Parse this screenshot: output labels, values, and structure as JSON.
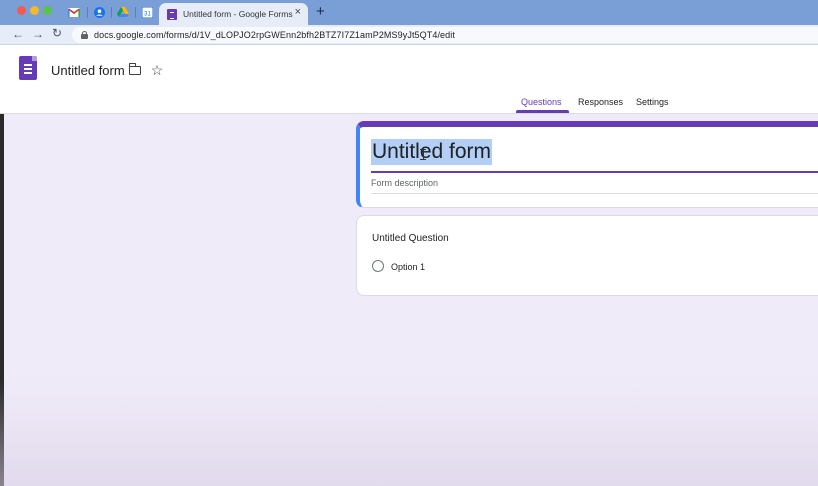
{
  "browser": {
    "tab_title": "Untitled form - Google Forms",
    "url": "docs.google.com/forms/d/1V_dLOPJO2rpGWEnn2bfh2BTZ7I7Z1amP2MS9yJt5QT4/edit",
    "new_tab_symbol": "+",
    "close_symbol": "×",
    "back_symbol": "←",
    "forward_symbol": "→",
    "reload_symbol": "↻",
    "pinned_tabs": [
      "gmail-icon",
      "account-icon",
      "drive-icon",
      "calendar-icon"
    ],
    "calendar_day": "31"
  },
  "header": {
    "doc_title": "Untitled form",
    "star_symbol": "☆",
    "tabs": [
      {
        "label": "Questions",
        "active": true
      },
      {
        "label": "Responses",
        "active": false
      },
      {
        "label": "Settings",
        "active": false
      }
    ]
  },
  "form": {
    "title": "Untitled form",
    "description_placeholder": "Form description"
  },
  "question": {
    "title": "Untitled Question",
    "options": [
      "Option 1"
    ]
  },
  "colors": {
    "accent": "#673ab7",
    "page_bg": "#f0ebf8",
    "tabbar": "#7a9fd6",
    "selection": "#b3cff5"
  }
}
